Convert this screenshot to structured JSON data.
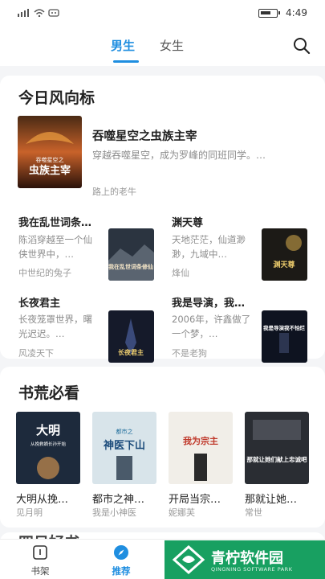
{
  "status_bar": {
    "time": "4:49",
    "battery_level": 0.7
  },
  "tabs": [
    {
      "label": "男生",
      "active": true
    },
    {
      "label": "女生",
      "active": false
    }
  ],
  "featured_section": {
    "title": "今日风向标",
    "main_book": {
      "title": "吞噬星空之虫族主宰",
      "description": "穿越吞噬星空，成为罗峰的同班同学。…",
      "author": "路上的老牛",
      "cover_text": "虫族主宰",
      "cover_series": "吞噬星空之"
    },
    "books": [
      {
        "title": "我在乱世词条…",
        "description": "陈滔穿越至一个仙侠世界中，…",
        "author": "中世纪的兔子",
        "cover_text": "我在乱世词条修仙"
      },
      {
        "title": "渊天尊",
        "description": "天地茫茫，仙道渺渺，九域中…",
        "author": "烽仙",
        "cover_text": "渊天尊"
      },
      {
        "title": "长夜君主",
        "description": "长夜笼罩世界，曙光迟迟。…",
        "author": "风凌天下",
        "cover_text": "长夜君主"
      },
      {
        "title": "我是导演，我…",
        "description": "2006年，许鑫做了一个梦，…",
        "author": "不是老狗",
        "cover_text": "我是导演我不怕烂"
      }
    ]
  },
  "must_read_section": {
    "title": "书荒必看",
    "books": [
      {
        "title": "大明从挽…",
        "author": "见月明",
        "cover_text": "大明",
        "cover_sub": "从挽救嫡长孙开始"
      },
      {
        "title": "都市之神…",
        "author": "我是小神医",
        "cover_text": "神医下山",
        "cover_sub": "都市之"
      },
      {
        "title": "开局当宗…",
        "author": "妮娜芙",
        "cover_text": "我为宗主"
      },
      {
        "title": "那就让她…",
        "author": "常世",
        "cover_text": "那就让她们献上忠诚吧"
      }
    ]
  },
  "next_section_peek": "四日好书",
  "bottom_nav": [
    {
      "label": "书架",
      "icon": "bookshelf-icon",
      "active": false
    },
    {
      "label": "推荐",
      "icon": "compass-icon",
      "active": true
    }
  ],
  "watermark": {
    "text": "青柠软件园",
    "sub": "QINGNING SOFTWARE PARK"
  },
  "colors": {
    "accent": "#1f8ee0",
    "watermark_green": "#18a061"
  }
}
